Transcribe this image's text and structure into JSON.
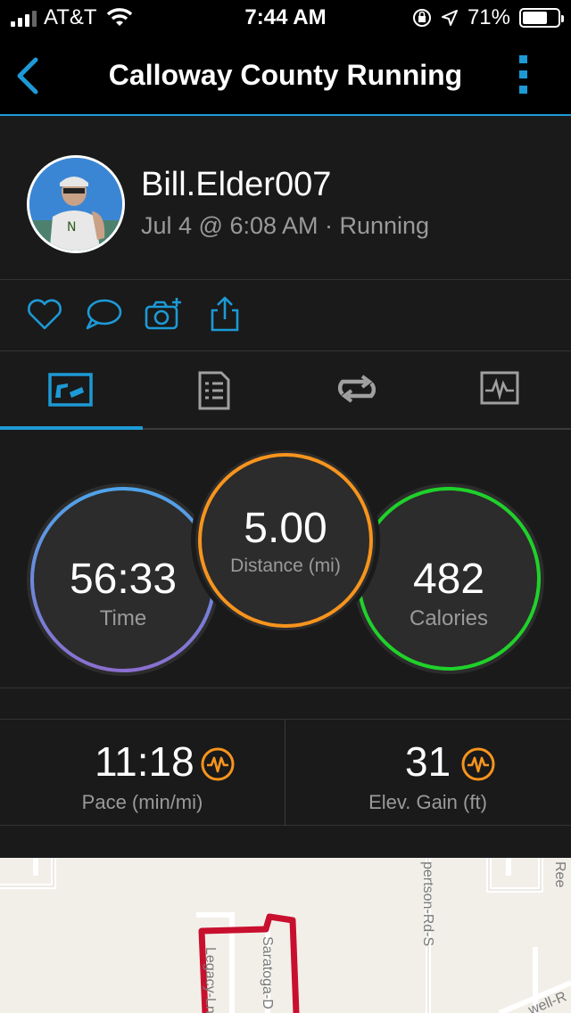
{
  "status_bar": {
    "carrier": "AT&T",
    "time": "7:44 AM",
    "battery": "71%",
    "battery_level": 0.71
  },
  "nav": {
    "title": "Calloway County Running",
    "back_icon": "chevron-left-icon",
    "more_icon": "more-vertical-icon"
  },
  "profile": {
    "user_name": "Bill.Elder007",
    "activity_meta": "Jul 4 @ 6:08 AM · Running"
  },
  "actions": [
    "heart-icon",
    "comment-icon",
    "camera-add-icon",
    "share-icon"
  ],
  "tabs": [
    {
      "icon": "overview-icon",
      "active": true
    },
    {
      "icon": "details-icon",
      "active": false
    },
    {
      "icon": "laps-icon",
      "active": false
    },
    {
      "icon": "charts-icon",
      "active": false
    }
  ],
  "stats": {
    "time": {
      "value": "56:33",
      "label": "Time"
    },
    "distance": {
      "value": "5.00",
      "label": "Distance (mi)"
    },
    "calories": {
      "value": "482",
      "label": "Calories"
    }
  },
  "secondary_stats": {
    "pace": {
      "value": "11:18",
      "label": "Pace (min/mi)"
    },
    "elevation": {
      "value": "31",
      "label": "Elev. Gain (ft)"
    }
  },
  "map": {
    "streets": [
      "Legacy-Ln",
      "Saratoga-D",
      "pertson-Rd-S",
      "Ree",
      "well-R"
    ]
  },
  "colors": {
    "accent": "#1d9ad6",
    "time_ring": "#5a8fd8",
    "distance_ring": "#f7941d",
    "calories_ring": "#1fd12a",
    "badge": "#f7941d",
    "route": "#c8102e"
  }
}
